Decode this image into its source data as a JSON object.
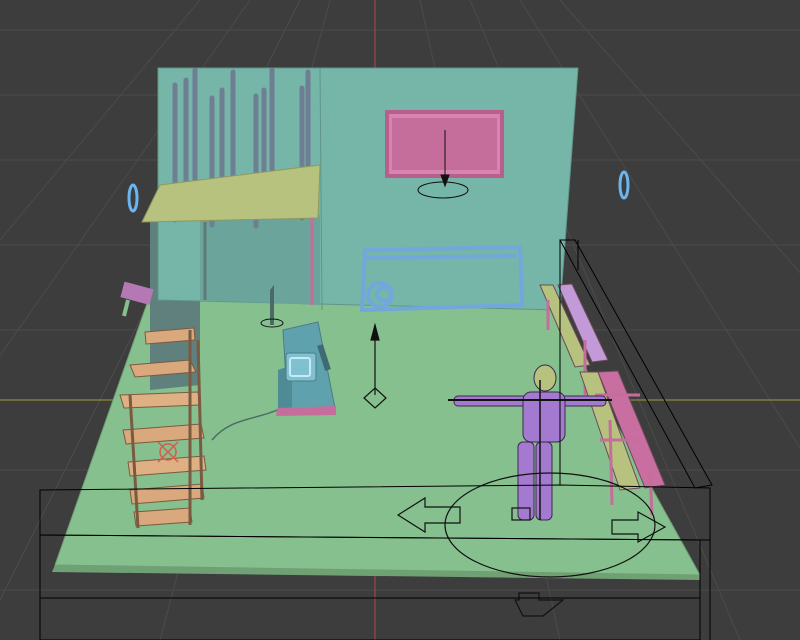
{
  "app": {
    "name": "",
    "view": "3D Viewport"
  },
  "viewport": {
    "background": "#3d3d3d",
    "grid_color": "#4a4a4a",
    "axis_x_color": "#9a9a3a",
    "axis_y_color": "#b0484d",
    "selection_color": "#000000"
  },
  "scene": {
    "objects": [
      {
        "name": "floor",
        "color": "#86c08e"
      },
      {
        "name": "back-wall",
        "color": "#76b6a8"
      },
      {
        "name": "loft-platform",
        "color": "#b6c27e"
      },
      {
        "name": "hanging-poles",
        "color": "#6e7f93"
      },
      {
        "name": "wall-picture",
        "color": "#c56e9b"
      },
      {
        "name": "whiteboard-sketch",
        "color": "#70a8dc"
      },
      {
        "name": "shelf-unit",
        "color": "#d9a87d"
      },
      {
        "name": "machine",
        "color": "#5fa2ad"
      },
      {
        "name": "benches",
        "color": "#c96ea0"
      },
      {
        "name": "character-rig",
        "color": "#a47ad0"
      },
      {
        "name": "wall-lamp",
        "color": "#b478b4"
      }
    ],
    "gizmos": [
      "move-arrows",
      "rotate-circle",
      "empty-axes",
      "lights"
    ]
  }
}
